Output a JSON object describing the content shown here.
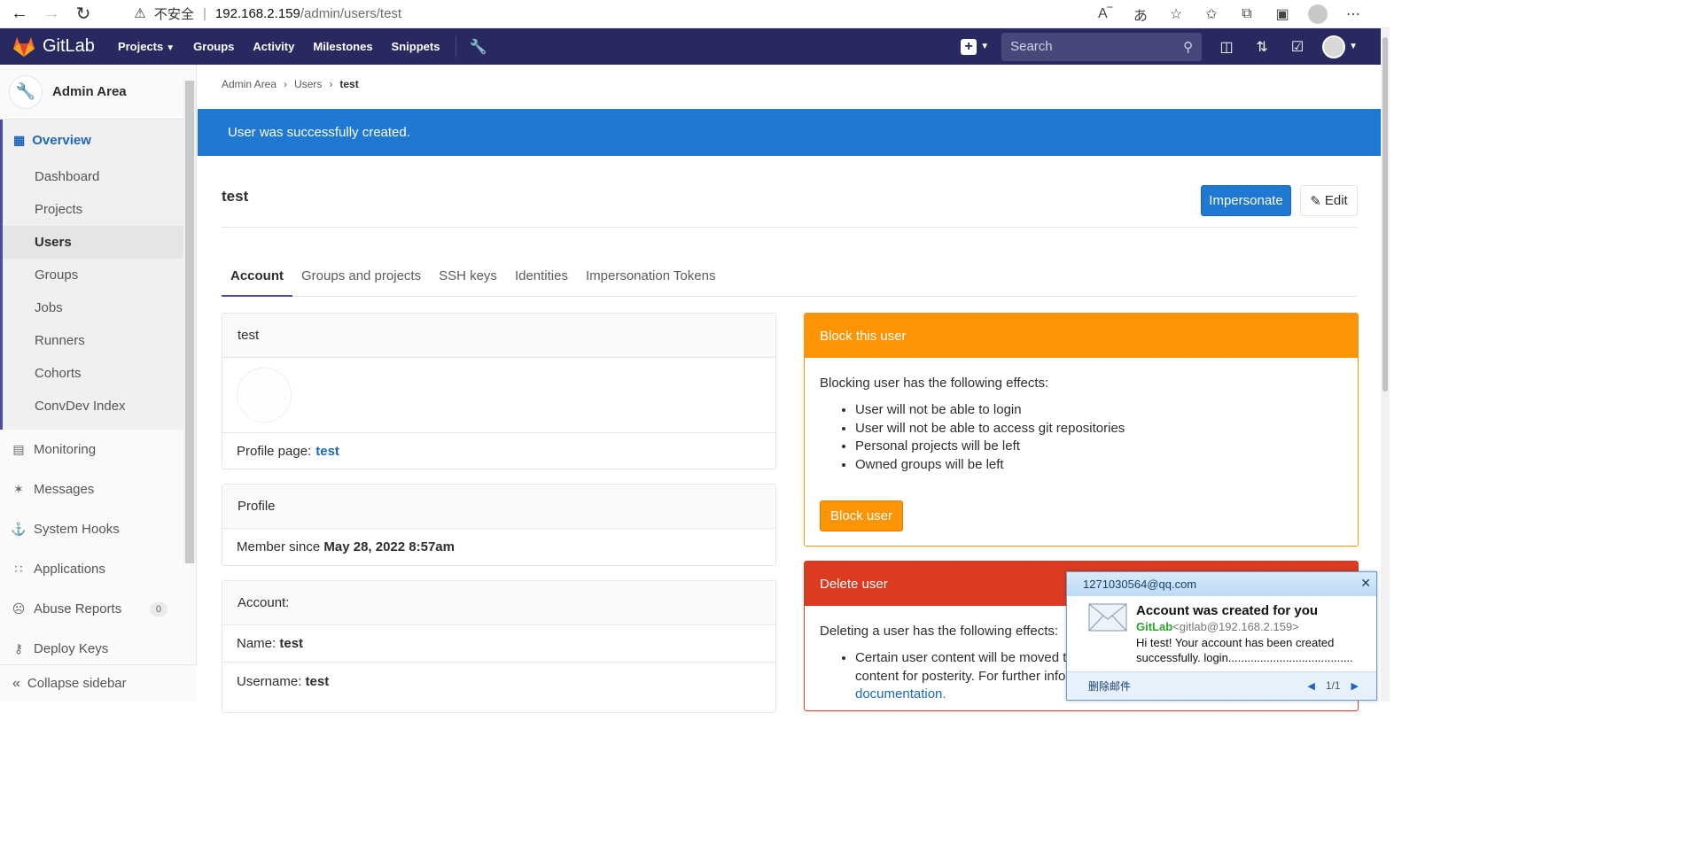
{
  "browser": {
    "insecure_label": "不安全",
    "url_host": "192.168.2.159",
    "url_path": "/admin/users/test"
  },
  "header": {
    "brand": "GitLab",
    "nav": [
      "Projects",
      "Groups",
      "Activity",
      "Milestones",
      "Snippets"
    ],
    "search_placeholder": "Search"
  },
  "sidebar": {
    "title": "Admin Area",
    "overview": "Overview",
    "sub_items": [
      "Dashboard",
      "Projects",
      "Users",
      "Groups",
      "Jobs",
      "Runners",
      "Cohorts",
      "ConvDev Index"
    ],
    "items": [
      "Monitoring",
      "Messages",
      "System Hooks",
      "Applications",
      "Abuse Reports",
      "Deploy Keys"
    ],
    "abuse_count": "0",
    "collapse": "Collapse sidebar"
  },
  "breadcrumb": [
    "Admin Area",
    "Users",
    "test"
  ],
  "flash": "User was successfully created.",
  "page_title": "test",
  "buttons": {
    "impersonate": "Impersonate",
    "edit": "Edit"
  },
  "tabs": [
    "Account",
    "Groups and projects",
    "SSH keys",
    "Identities",
    "Impersonation Tokens"
  ],
  "user_panel": {
    "header": "test",
    "profile_label": "Profile page:",
    "profile_link": "test"
  },
  "profile_panel": {
    "header": "Profile",
    "member_label": "Member since",
    "member_value": "May 28, 2022 8:57am"
  },
  "account_panel": {
    "header": "Account:",
    "name_label": "Name:",
    "name_value": "test",
    "username_label": "Username:",
    "username_value": "test"
  },
  "block_panel": {
    "header": "Block this user",
    "intro": "Blocking user has the following effects:",
    "effects": [
      "User will not be able to login",
      "User will not be able to access git repositories",
      "Personal projects will be left",
      "Owned groups will be left"
    ],
    "button": "Block user"
  },
  "delete_panel": {
    "header": "Delete user",
    "intro": "Deleting a user has the following effects:",
    "effect_line1": "Certain user content will be moved to",
    "effect_line2": "content for posterity. For further infor",
    "link": "documentation."
  },
  "notification": {
    "account": "1271030564@qq.com",
    "subject": "Account was created for you",
    "from_name": "GitLab",
    "from_addr": "<gitlab@192.168.2.159>",
    "body": "Hi test! Your account has been created successfully. login.......................................",
    "delete": "删除邮件",
    "pager": "1/1"
  }
}
